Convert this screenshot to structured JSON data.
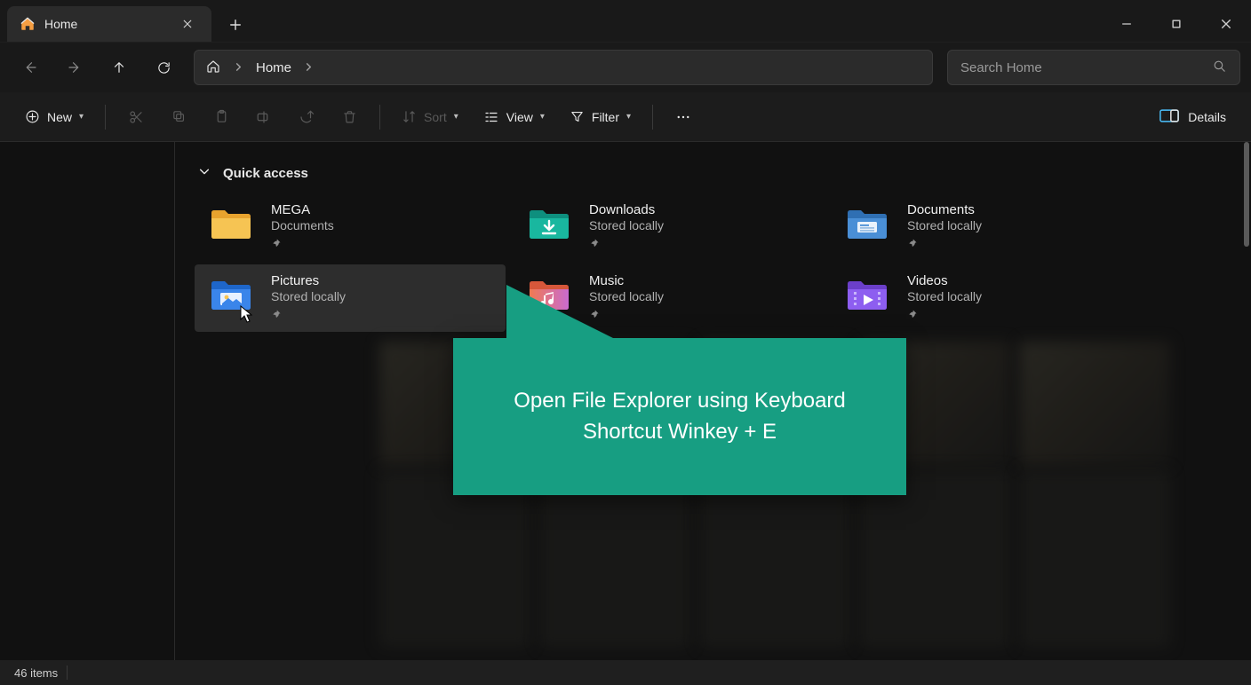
{
  "window": {
    "tab_label": "Home"
  },
  "address": {
    "crumb": "Home"
  },
  "search": {
    "placeholder": "Search Home"
  },
  "toolbar": {
    "new": "New",
    "sort": "Sort",
    "view": "View",
    "filter": "Filter",
    "details": "Details"
  },
  "section": {
    "quick_access": "Quick access"
  },
  "quick_access": [
    {
      "name": "MEGA",
      "sub": "Documents",
      "icon": "folder-yellow"
    },
    {
      "name": "Downloads",
      "sub": "Stored locally",
      "icon": "downloads"
    },
    {
      "name": "Documents",
      "sub": "Stored locally",
      "icon": "documents"
    },
    {
      "name": "Pictures",
      "sub": "Stored locally",
      "icon": "pictures",
      "hovered": true
    },
    {
      "name": "Music",
      "sub": "Stored locally",
      "icon": "music"
    },
    {
      "name": "Videos",
      "sub": "Stored locally",
      "icon": "videos"
    }
  ],
  "callout": {
    "text": "Open File Explorer using Keyboard Shortcut Winkey + E"
  },
  "status": {
    "items": "46 items"
  }
}
